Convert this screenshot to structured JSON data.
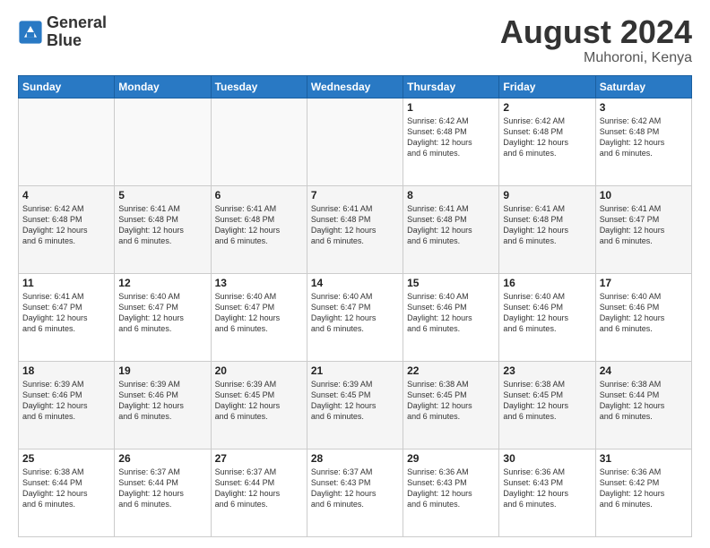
{
  "header": {
    "logo_line1": "General",
    "logo_line2": "Blue",
    "month_title": "August 2024",
    "location": "Muhoroni, Kenya"
  },
  "weekdays": [
    "Sunday",
    "Monday",
    "Tuesday",
    "Wednesday",
    "Thursday",
    "Friday",
    "Saturday"
  ],
  "weeks": [
    [
      {
        "day": "",
        "info": ""
      },
      {
        "day": "",
        "info": ""
      },
      {
        "day": "",
        "info": ""
      },
      {
        "day": "",
        "info": ""
      },
      {
        "day": "1",
        "info": "Sunrise: 6:42 AM\nSunset: 6:48 PM\nDaylight: 12 hours\nand 6 minutes."
      },
      {
        "day": "2",
        "info": "Sunrise: 6:42 AM\nSunset: 6:48 PM\nDaylight: 12 hours\nand 6 minutes."
      },
      {
        "day": "3",
        "info": "Sunrise: 6:42 AM\nSunset: 6:48 PM\nDaylight: 12 hours\nand 6 minutes."
      }
    ],
    [
      {
        "day": "4",
        "info": "Sunrise: 6:42 AM\nSunset: 6:48 PM\nDaylight: 12 hours\nand 6 minutes."
      },
      {
        "day": "5",
        "info": "Sunrise: 6:41 AM\nSunset: 6:48 PM\nDaylight: 12 hours\nand 6 minutes."
      },
      {
        "day": "6",
        "info": "Sunrise: 6:41 AM\nSunset: 6:48 PM\nDaylight: 12 hours\nand 6 minutes."
      },
      {
        "day": "7",
        "info": "Sunrise: 6:41 AM\nSunset: 6:48 PM\nDaylight: 12 hours\nand 6 minutes."
      },
      {
        "day": "8",
        "info": "Sunrise: 6:41 AM\nSunset: 6:48 PM\nDaylight: 12 hours\nand 6 minutes."
      },
      {
        "day": "9",
        "info": "Sunrise: 6:41 AM\nSunset: 6:48 PM\nDaylight: 12 hours\nand 6 minutes."
      },
      {
        "day": "10",
        "info": "Sunrise: 6:41 AM\nSunset: 6:47 PM\nDaylight: 12 hours\nand 6 minutes."
      }
    ],
    [
      {
        "day": "11",
        "info": "Sunrise: 6:41 AM\nSunset: 6:47 PM\nDaylight: 12 hours\nand 6 minutes."
      },
      {
        "day": "12",
        "info": "Sunrise: 6:40 AM\nSunset: 6:47 PM\nDaylight: 12 hours\nand 6 minutes."
      },
      {
        "day": "13",
        "info": "Sunrise: 6:40 AM\nSunset: 6:47 PM\nDaylight: 12 hours\nand 6 minutes."
      },
      {
        "day": "14",
        "info": "Sunrise: 6:40 AM\nSunset: 6:47 PM\nDaylight: 12 hours\nand 6 minutes."
      },
      {
        "day": "15",
        "info": "Sunrise: 6:40 AM\nSunset: 6:46 PM\nDaylight: 12 hours\nand 6 minutes."
      },
      {
        "day": "16",
        "info": "Sunrise: 6:40 AM\nSunset: 6:46 PM\nDaylight: 12 hours\nand 6 minutes."
      },
      {
        "day": "17",
        "info": "Sunrise: 6:40 AM\nSunset: 6:46 PM\nDaylight: 12 hours\nand 6 minutes."
      }
    ],
    [
      {
        "day": "18",
        "info": "Sunrise: 6:39 AM\nSunset: 6:46 PM\nDaylight: 12 hours\nand 6 minutes."
      },
      {
        "day": "19",
        "info": "Sunrise: 6:39 AM\nSunset: 6:46 PM\nDaylight: 12 hours\nand 6 minutes."
      },
      {
        "day": "20",
        "info": "Sunrise: 6:39 AM\nSunset: 6:45 PM\nDaylight: 12 hours\nand 6 minutes."
      },
      {
        "day": "21",
        "info": "Sunrise: 6:39 AM\nSunset: 6:45 PM\nDaylight: 12 hours\nand 6 minutes."
      },
      {
        "day": "22",
        "info": "Sunrise: 6:38 AM\nSunset: 6:45 PM\nDaylight: 12 hours\nand 6 minutes."
      },
      {
        "day": "23",
        "info": "Sunrise: 6:38 AM\nSunset: 6:45 PM\nDaylight: 12 hours\nand 6 minutes."
      },
      {
        "day": "24",
        "info": "Sunrise: 6:38 AM\nSunset: 6:44 PM\nDaylight: 12 hours\nand 6 minutes."
      }
    ],
    [
      {
        "day": "25",
        "info": "Sunrise: 6:38 AM\nSunset: 6:44 PM\nDaylight: 12 hours\nand 6 minutes."
      },
      {
        "day": "26",
        "info": "Sunrise: 6:37 AM\nSunset: 6:44 PM\nDaylight: 12 hours\nand 6 minutes."
      },
      {
        "day": "27",
        "info": "Sunrise: 6:37 AM\nSunset: 6:44 PM\nDaylight: 12 hours\nand 6 minutes."
      },
      {
        "day": "28",
        "info": "Sunrise: 6:37 AM\nSunset: 6:43 PM\nDaylight: 12 hours\nand 6 minutes."
      },
      {
        "day": "29",
        "info": "Sunrise: 6:36 AM\nSunset: 6:43 PM\nDaylight: 12 hours\nand 6 minutes."
      },
      {
        "day": "30",
        "info": "Sunrise: 6:36 AM\nSunset: 6:43 PM\nDaylight: 12 hours\nand 6 minutes."
      },
      {
        "day": "31",
        "info": "Sunrise: 6:36 AM\nSunset: 6:42 PM\nDaylight: 12 hours\nand 6 minutes."
      }
    ]
  ]
}
